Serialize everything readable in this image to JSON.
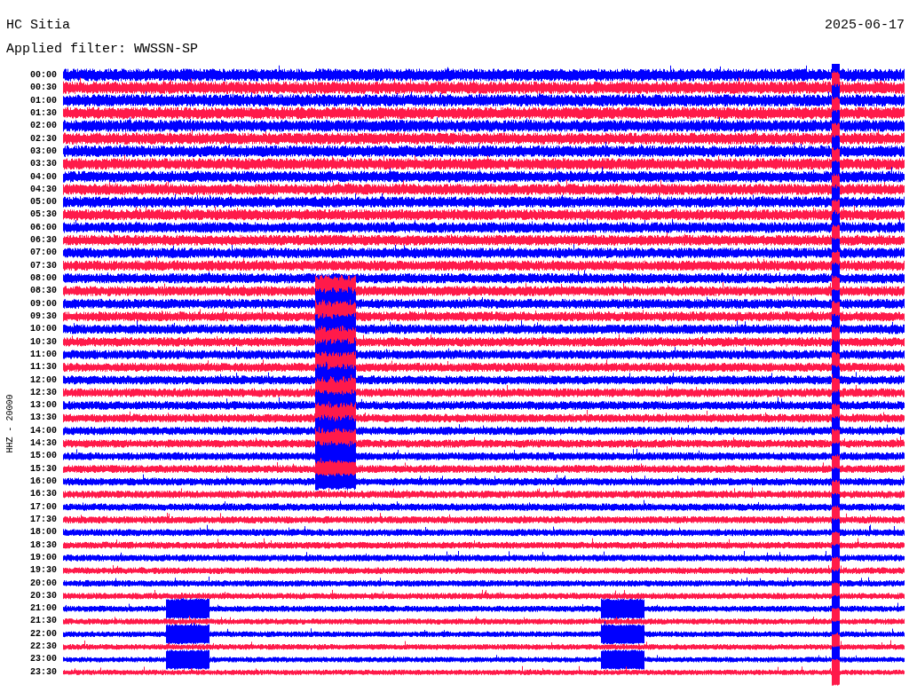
{
  "header": {
    "station": "HC Sitia",
    "date": "2025-06-17",
    "filter": "Applied filter: WWSSN-SP"
  },
  "axis_label": "HHZ - 20000",
  "rows": [
    {
      "time": "00:00",
      "color": "#0000ff"
    },
    {
      "time": "00:30",
      "color": "#ff1a4a"
    },
    {
      "time": "01:00",
      "color": "#0000ff"
    },
    {
      "time": "01:30",
      "color": "#ff1a4a"
    },
    {
      "time": "02:00",
      "color": "#0000ff"
    },
    {
      "time": "02:30",
      "color": "#ff1a4a"
    },
    {
      "time": "03:00",
      "color": "#0000ff"
    },
    {
      "time": "03:30",
      "color": "#ff1a4a"
    },
    {
      "time": "04:00",
      "color": "#0000ff"
    },
    {
      "time": "04:30",
      "color": "#ff1a4a"
    },
    {
      "time": "05:00",
      "color": "#0000ff"
    },
    {
      "time": "05:30",
      "color": "#ff1a4a"
    },
    {
      "time": "06:00",
      "color": "#0000ff"
    },
    {
      "time": "06:30",
      "color": "#ff1a4a"
    },
    {
      "time": "07:00",
      "color": "#0000ff"
    },
    {
      "time": "07:30",
      "color": "#ff1a4a"
    },
    {
      "time": "08:00",
      "color": "#0000ff"
    },
    {
      "time": "08:30",
      "color": "#ff1a4a"
    },
    {
      "time": "09:00",
      "color": "#0000ff"
    },
    {
      "time": "09:30",
      "color": "#ff1a4a"
    },
    {
      "time": "10:00",
      "color": "#0000ff"
    },
    {
      "time": "10:30",
      "color": "#ff1a4a"
    },
    {
      "time": "11:00",
      "color": "#0000ff"
    },
    {
      "time": "11:30",
      "color": "#ff1a4a"
    },
    {
      "time": "12:00",
      "color": "#0000ff"
    },
    {
      "time": "12:30",
      "color": "#ff1a4a"
    },
    {
      "time": "13:00",
      "color": "#0000ff"
    },
    {
      "time": "13:30",
      "color": "#ff1a4a"
    },
    {
      "time": "14:00",
      "color": "#0000ff"
    },
    {
      "time": "14:30",
      "color": "#ff1a4a"
    },
    {
      "time": "15:00",
      "color": "#0000ff"
    },
    {
      "time": "15:30",
      "color": "#ff1a4a"
    },
    {
      "time": "16:00",
      "color": "#0000ff"
    },
    {
      "time": "16:30",
      "color": "#ff1a4a"
    },
    {
      "time": "17:00",
      "color": "#0000ff"
    },
    {
      "time": "17:30",
      "color": "#ff1a4a"
    },
    {
      "time": "18:00",
      "color": "#0000ff"
    },
    {
      "time": "18:30",
      "color": "#ff1a4a"
    },
    {
      "time": "19:00",
      "color": "#0000ff"
    },
    {
      "time": "19:30",
      "color": "#ff1a4a"
    },
    {
      "time": "20:00",
      "color": "#0000ff"
    },
    {
      "time": "20:30",
      "color": "#ff1a4a"
    },
    {
      "time": "21:00",
      "color": "#0000ff"
    },
    {
      "time": "21:30",
      "color": "#ff1a4a"
    },
    {
      "time": "22:00",
      "color": "#0000ff"
    },
    {
      "time": "22:30",
      "color": "#ff1a4a"
    },
    {
      "time": "23:00",
      "color": "#0000ff"
    },
    {
      "time": "23:30",
      "color": "#ff1a4a"
    }
  ]
}
